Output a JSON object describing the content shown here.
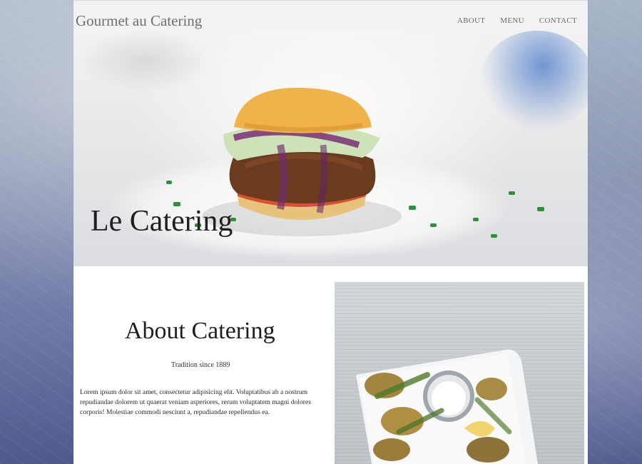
{
  "site": {
    "brand": "Gourmet au Catering"
  },
  "nav": {
    "items": [
      "ABOUT",
      "MENU",
      "CONTACT"
    ]
  },
  "hero": {
    "title": "Le Catering"
  },
  "about": {
    "heading": "About Catering",
    "subheading": "Tradition since 1889",
    "body": "Lorem ipsum dolor sit amet, consectetur adipisicing elit. Voluptatibus ab a nostrum repudiandae dolorem ut quaerat veniam asperiores, rerum voluptatem magni dolores corporis! Molestiae commodi nesciunt a, repudiandae repellendus ea."
  }
}
